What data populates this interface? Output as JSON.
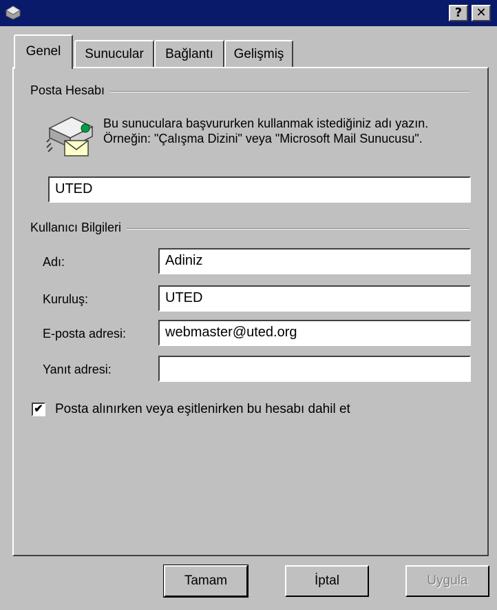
{
  "window": {
    "title": "",
    "help_label": "?",
    "close_label": "✕"
  },
  "tabs": [
    {
      "label": "Genel",
      "active": true
    },
    {
      "label": "Sunucular",
      "active": false
    },
    {
      "label": "Bağlantı",
      "active": false
    },
    {
      "label": "Gelişmiş",
      "active": false
    }
  ],
  "posta_hesabi": {
    "group_label": "Posta Hesabı",
    "description": "Bu sunuculara başvururken kullanmak istediğiniz adı yazın.  Örneğin: \"Çalışma Dizini\" veya \"Microsoft Mail Sunucusu\".",
    "account_name": "UTED"
  },
  "kullanici_bilgileri": {
    "group_label": "Kullanıcı Bilgileri",
    "name_label": "Adı:",
    "name_value": "Adiniz",
    "org_label": "Kuruluş:",
    "org_value": "UTED",
    "email_label": "E-posta adresi:",
    "email_value": "webmaster@uted.org",
    "reply_label": "Yanıt adresi:",
    "reply_value": ""
  },
  "include_account": {
    "checked": true,
    "label": "Posta alınırken veya eşitlenirken bu hesabı dahil et"
  },
  "buttons": {
    "ok": "Tamam",
    "cancel": "İptal",
    "apply": "Uygula"
  },
  "colors": {
    "titlebar": "#0a1a6a",
    "face": "#c0c0c0"
  }
}
